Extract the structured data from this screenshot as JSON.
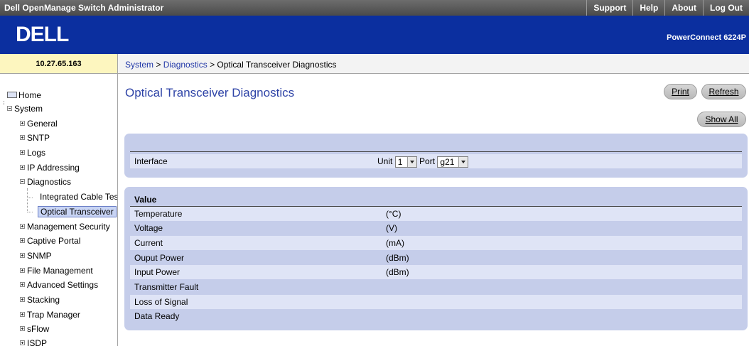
{
  "topbar": {
    "title": "Dell OpenManage Switch Administrator",
    "links": [
      "Support",
      "Help",
      "About",
      "Log Out"
    ]
  },
  "banner": {
    "logo_text": "DELL",
    "product": "PowerConnect 6224P"
  },
  "ip_address": "10.27.65.163",
  "breadcrumb": {
    "system": "System",
    "sep1": " > ",
    "diagnostics": "Diagnostics",
    "sep2": " > ",
    "current": "Optical Transceiver Diagnostics"
  },
  "sidebar": {
    "home": "Home",
    "system": "System",
    "items": [
      "General",
      "SNTP",
      "Logs",
      "IP Addressing",
      "Diagnostics"
    ],
    "diag_children": [
      "Integrated Cable Tes",
      "Optical Transceiver"
    ],
    "items_after": [
      "Management Security",
      "Captive Portal",
      "SNMP",
      "File Management",
      "Advanced Settings",
      "Stacking",
      "Trap Manager",
      "sFlow",
      "ISDP"
    ]
  },
  "page": {
    "title": "Optical Transceiver Diagnostics",
    "buttons": {
      "print": "Print",
      "refresh": "Refresh",
      "show_all": "Show All"
    }
  },
  "interface_panel": {
    "label": "Interface",
    "unit_label": "Unit",
    "unit_value": "1",
    "port_label": "Port",
    "port_value": "g21"
  },
  "value_panel": {
    "heading": "Value",
    "rows": [
      {
        "label": "Temperature",
        "unit": "(°C)"
      },
      {
        "label": "Voltage",
        "unit": "(V)"
      },
      {
        "label": "Current",
        "unit": "(mA)"
      },
      {
        "label": "Ouput Power",
        "unit": "(dBm)"
      },
      {
        "label": "Input Power",
        "unit": "(dBm)"
      },
      {
        "label": "Transmitter Fault",
        "unit": ""
      },
      {
        "label": "Loss of Signal",
        "unit": ""
      },
      {
        "label": "Data Ready",
        "unit": ""
      }
    ]
  },
  "colors": {
    "banner": "#0b2f9f",
    "panel": "#c5cdea",
    "row_alt": "#dfe4f6",
    "title_blue": "#2f44a7",
    "ip_background": "#fdf6bf"
  }
}
